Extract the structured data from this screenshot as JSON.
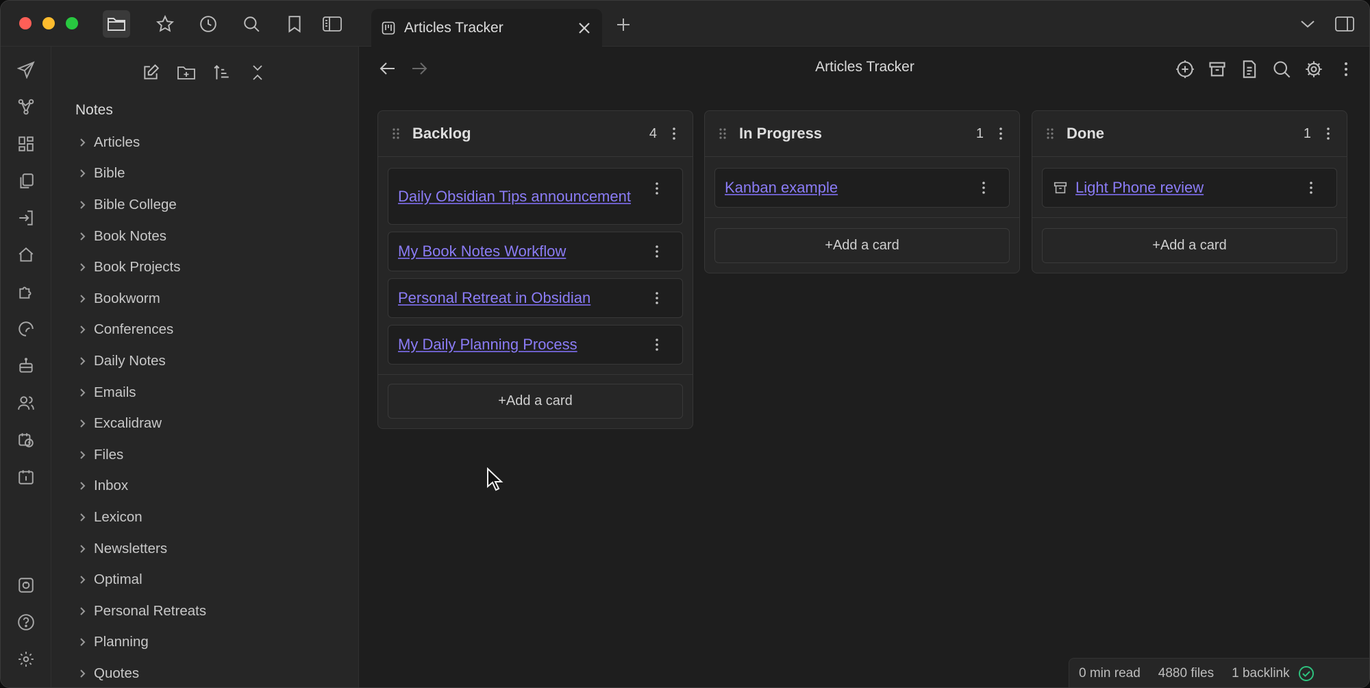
{
  "tab": {
    "title": "Articles Tracker"
  },
  "view": {
    "title": "Articles Tracker"
  },
  "sidebar": {
    "vault_name": "Notes",
    "folders": [
      "Articles",
      "Bible",
      "Bible College",
      "Book Notes",
      "Book Projects",
      "Bookworm",
      "Conferences",
      "Daily Notes",
      "Emails",
      "Excalidraw",
      "Files",
      "Inbox",
      "Lexicon",
      "Newsletters",
      "Optimal",
      "Personal Retreats",
      "Planning",
      "Quotes"
    ]
  },
  "board": {
    "add_card_label": "+Add a card",
    "lanes": [
      {
        "title": "Backlog",
        "count": "4",
        "cards": [
          "Daily Obsidian Tips announcement",
          "My Book Notes Workflow",
          "Personal Retreat in Obsidian",
          "My Daily Planning Process"
        ]
      },
      {
        "title": "In Progress",
        "count": "1",
        "cards": [
          "Kanban example"
        ]
      },
      {
        "title": "Done",
        "count": "1",
        "cards": [
          "Light Phone review"
        ]
      }
    ]
  },
  "status": {
    "read_time": "0 min read",
    "files": "4880 files",
    "backlinks": "1 backlink"
  },
  "colors": {
    "accent_link": "#8b7cf6",
    "background": "#1e1e1e",
    "panel": "#262626",
    "status_ok": "#2ec27e"
  }
}
